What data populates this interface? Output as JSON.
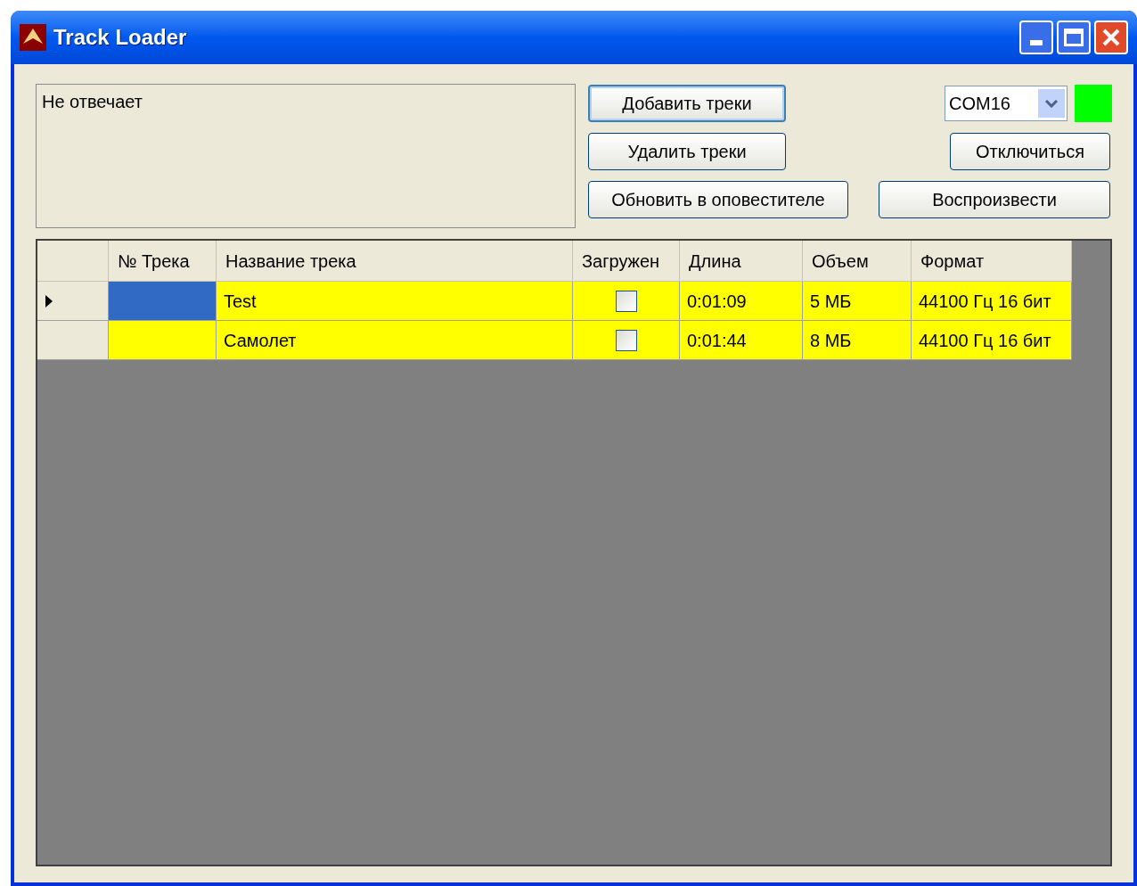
{
  "window": {
    "title": "Track Loader"
  },
  "status_text": "Не отвечает",
  "buttons": {
    "add": "Добавить треки",
    "remove": "Удалить треки",
    "update": "Обновить в оповестителе",
    "disconnect": "Отключиться",
    "play": "Воспроизвести"
  },
  "port": {
    "value": "COM16"
  },
  "connection_indicator": {
    "on": true
  },
  "table": {
    "columns": [
      "№ Трека",
      "Название трека",
      "Загружен",
      "Длина",
      "Объем",
      "Формат"
    ],
    "rows": [
      {
        "current": true,
        "number_selected": true,
        "title": "Test",
        "loaded": false,
        "length": "0:01:09",
        "size": "5 МБ",
        "format": "44100 Гц 16 бит"
      },
      {
        "current": false,
        "number_selected": false,
        "title": "Самолет",
        "loaded": false,
        "length": "0:01:44",
        "size": "8 МБ",
        "format": "44100 Гц 16 бит"
      }
    ]
  }
}
